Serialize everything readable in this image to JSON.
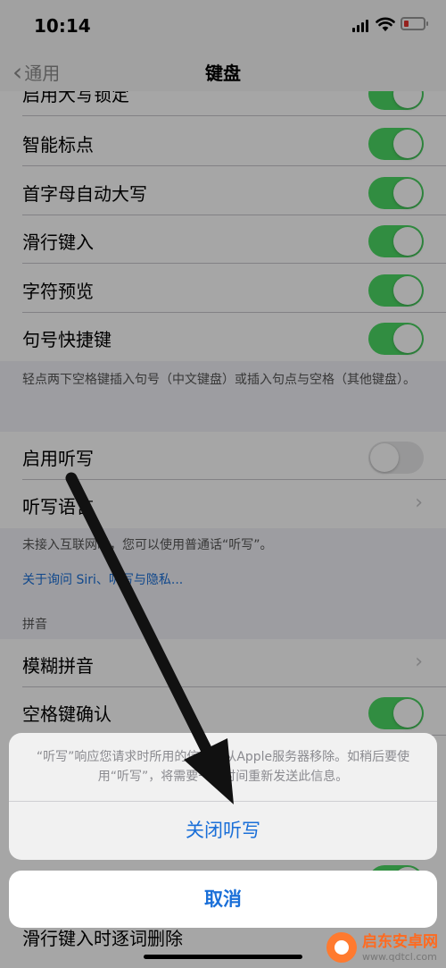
{
  "status": {
    "time": "10:14"
  },
  "nav": {
    "back_label": "通用",
    "title": "键盘"
  },
  "group1": {
    "rows": [
      {
        "label": "启用大写锁定",
        "toggle": "on"
      },
      {
        "label": "智能标点",
        "toggle": "on"
      },
      {
        "label": "首字母自动大写",
        "toggle": "on"
      },
      {
        "label": "滑行键入",
        "toggle": "on"
      },
      {
        "label": "字符预览",
        "toggle": "on"
      },
      {
        "label": "句号快捷键",
        "toggle": "on"
      }
    ],
    "footer": "轻点两下空格键插入句号（中文键盘）或插入句点与空格（其他键盘）。"
  },
  "group2": {
    "rows": [
      {
        "label": "启用听写",
        "toggle": "off"
      },
      {
        "label": "听写语言"
      }
    ],
    "footer": "未接入互联网时，您可以使用普通话“听写”。",
    "link": "关于询问 Siri、听写与隐私..."
  },
  "group3": {
    "header": "拼音",
    "rows": [
      {
        "label": "模糊拼音"
      },
      {
        "label": "空格键确认",
        "toggle": "on"
      }
    ],
    "partial_label": "滑行键入时逐词删除"
  },
  "sheet": {
    "message": "“听写”响应您请求时所用的信息将从Apple服务器移除。如稍后要使用“听写”，将需要一些时间重新发送此信息。",
    "action_label": "关闭听写",
    "cancel_label": "取消"
  },
  "watermark": {
    "name": "启东安卓网",
    "url": "www.qdtcl.com"
  },
  "colors": {
    "accent": "#1a6fd8",
    "toggle_on": "#4cd964",
    "arrow": "#111111"
  }
}
